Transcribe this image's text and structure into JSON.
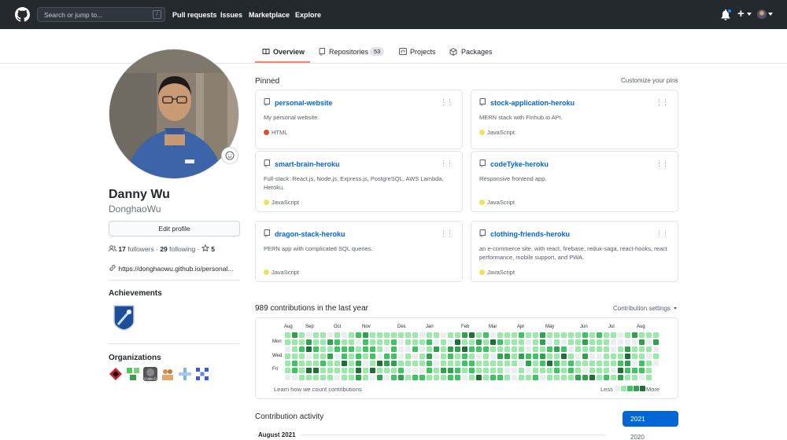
{
  "header": {
    "search_placeholder": "Search or jump to...",
    "search_shortcut": "/",
    "nav": [
      "Pull requests",
      "Issues",
      "Marketplace",
      "Explore"
    ],
    "plus_symbol": "+"
  },
  "tabs": [
    {
      "label": "Overview",
      "icon": "book-icon",
      "active": true
    },
    {
      "label": "Repositories",
      "icon": "repo-icon",
      "count": "53"
    },
    {
      "label": "Projects",
      "icon": "project-icon"
    },
    {
      "label": "Packages",
      "icon": "package-icon"
    }
  ],
  "profile": {
    "name": "Danny Wu",
    "login": "DonghaoWu",
    "edit_label": "Edit profile",
    "followers_count": "17",
    "followers_label": "followers",
    "separator": " · ",
    "following_count": "29",
    "following_label": "following",
    "stars_count": "5",
    "website": "https://donghaowu.github.io/personal..."
  },
  "achievements": {
    "heading": "Achievements"
  },
  "organizations": {
    "heading": "Organizations",
    "items": [
      "org-red-diamond",
      "org-green-grid",
      "Code-O",
      "org-orange-people",
      "org-blue-cross",
      "org-blue-pattern"
    ]
  },
  "pinned": {
    "heading": "Pinned",
    "customize": "Customize your pins",
    "cards": [
      {
        "name": "personal-website",
        "desc": "My personal website.",
        "lang": "HTML",
        "color": "#e34c26"
      },
      {
        "name": "stock-application-heroku",
        "desc": "MERN stack with Finhub.io API.",
        "lang": "JavaScript",
        "color": "#f1e05a"
      },
      {
        "name": "smart-brain-heroku",
        "desc": "Full-stack: React.js, Node.js, Express.js, PostgreSQL, AWS Lambda, Heroku.",
        "lang": "JavaScript",
        "color": "#f1e05a"
      },
      {
        "name": "codeTyke-heroku",
        "desc": "Responsive frontend app.",
        "lang": "JavaScript",
        "color": "#f1e05a"
      },
      {
        "name": "dragon-stack-heroku",
        "desc": "PERN app with complicated SQL queries.",
        "lang": "JavaScript",
        "color": "#f1e05a"
      },
      {
        "name": "clothing-friends-heroku",
        "desc": "an e-commerce site, with react, firebase, redux-saga, react-hooks, react performance, mobile support, and PWA.",
        "lang": "JavaScript",
        "color": "#f1e05a"
      }
    ]
  },
  "contributions": {
    "heading": "989 contributions in the last year",
    "settings": "Contribution settings",
    "months": [
      "Aug",
      "Sep",
      "Oct",
      "Nov",
      "Dec",
      "Jan",
      "Feb",
      "Mar",
      "Apr",
      "May",
      "Jun",
      "Jul",
      "Aug"
    ],
    "days": [
      "Mon",
      "Wed",
      "Fri"
    ],
    "learn": "Learn how we count contributions",
    "less": "Less",
    "more": "More",
    "colors": [
      "#ebedf0",
      "#9be9a8",
      "#40c463",
      "#30a14e",
      "#216e39"
    ]
  },
  "activity": {
    "heading": "Contribution activity",
    "month": "August 2021",
    "years": [
      "2021",
      "2020"
    ]
  }
}
